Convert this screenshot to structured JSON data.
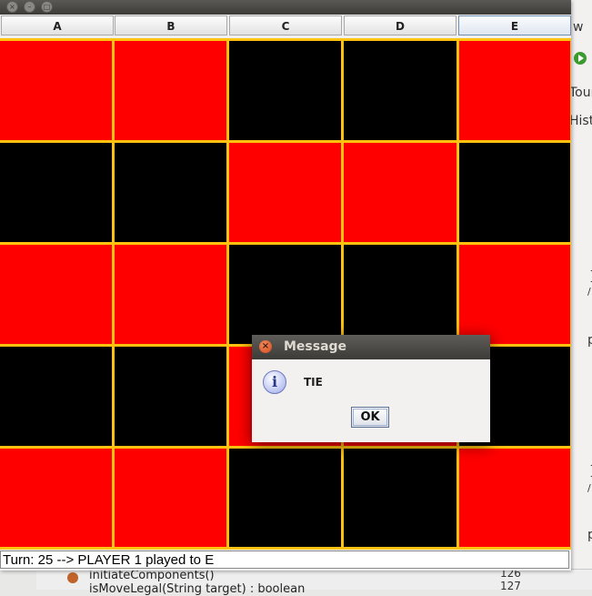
{
  "ide_fragments": {
    "menu_tail": "w",
    "tab1": "Tour",
    "tab2": "Hist",
    "brace1": "}",
    "slash1": "/",
    "p1": "p",
    "brace2": "}",
    "slash2": "/",
    "p2": "p",
    "method1": "initiateComponents()",
    "method2": "isMoveLegal(String target) : boolean",
    "line1": "126",
    "line2": "127"
  },
  "columns": [
    "A",
    "B",
    "C",
    "D",
    "E"
  ],
  "board": [
    [
      "red",
      "red",
      "black",
      "black",
      "red"
    ],
    [
      "black",
      "black",
      "red",
      "red",
      "black"
    ],
    [
      "red",
      "red",
      "black",
      "black",
      "red"
    ],
    [
      "black",
      "black",
      "red",
      "red",
      "black"
    ],
    [
      "red",
      "red",
      "black",
      "black",
      "red"
    ]
  ],
  "colors": {
    "red": "#ff0000",
    "black": "#000000",
    "grid": "#ffc20e"
  },
  "status": {
    "text": "Turn: 25 --> PLAYER 1 played to E"
  },
  "dialog": {
    "title": "Message",
    "message": "TIE",
    "ok_label": "OK",
    "icon": "info-icon",
    "close_icon": "×",
    "info_glyph": "i"
  }
}
